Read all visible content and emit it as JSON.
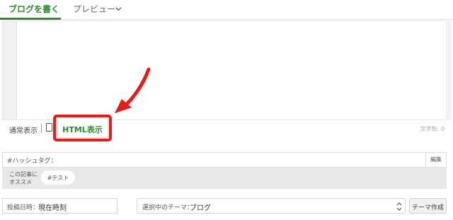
{
  "tabs": {
    "write_label": "ブログを書く",
    "preview_label": "プレビュー"
  },
  "editor": {
    "mode_normal_label": "通常表示",
    "mode_html_label": "HTML表示",
    "char_count_label": "文字数: 0"
  },
  "hashtags": {
    "label": "#ハッシュタグ：",
    "edit_label": "編集",
    "recommend_label_line1": "この記事に",
    "recommend_label_line2": "オススメ",
    "suggested_tag": "#テスト"
  },
  "footer": {
    "post_date_label": "投稿日時：",
    "post_date_value": "現在時刻",
    "theme_label": "選択中のテーマ：",
    "theme_value": "ブログ",
    "create_theme_label": "テーマ作成"
  },
  "colors": {
    "accent_green": "#2e8b2e",
    "highlight_red": "#e21b1b"
  },
  "icons": {
    "preview_dropdown": "chevron-down-icon",
    "callout_arrow": "arrow-icon",
    "theme_select": "select-updown-icon"
  }
}
